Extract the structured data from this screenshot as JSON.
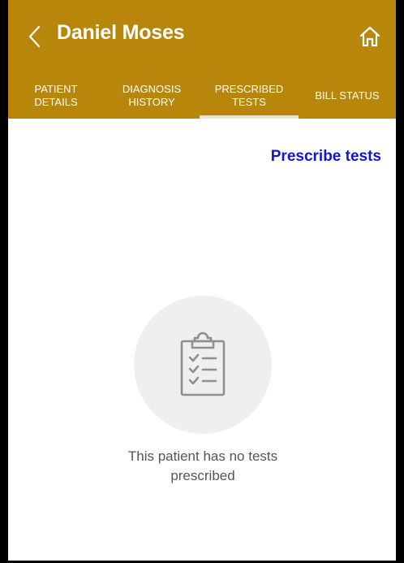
{
  "header": {
    "title": "Daniel Moses",
    "back_icon": "chevron-left-icon",
    "home_icon": "home-icon"
  },
  "tabs": [
    {
      "label": "PATIENT\nDETAILS",
      "active": false
    },
    {
      "label": "DIAGNOSIS\nHISTORY",
      "active": false
    },
    {
      "label": "PRESCRIBED\nTESTS",
      "active": true
    },
    {
      "label": "BILL STATUS",
      "active": false
    }
  ],
  "actions": {
    "prescribe_label": "Prescribe tests"
  },
  "empty_state": {
    "icon": "clipboard-checklist-icon",
    "message": "This patient has no tests\nprescribed"
  },
  "colors": {
    "appbar": "#b8860b",
    "accent_link": "#1414d6",
    "tab_indicator": "#ece3d0"
  }
}
